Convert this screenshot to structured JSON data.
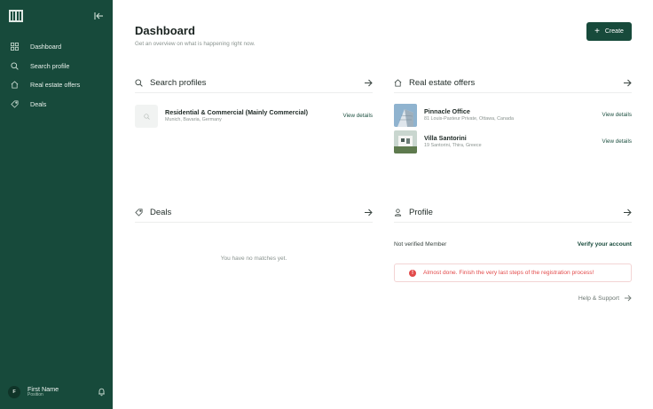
{
  "sidebar": {
    "items": [
      {
        "label": "Dashboard",
        "icon": "grid-icon"
      },
      {
        "label": "Search profile",
        "icon": "search-icon"
      },
      {
        "label": "Real estate offers",
        "icon": "home-icon"
      },
      {
        "label": "Deals",
        "icon": "tag-icon"
      }
    ],
    "user": {
      "initial": "F",
      "name": "First Name",
      "position": "Position"
    }
  },
  "header": {
    "title": "Dashboard",
    "subtitle": "Get an overview on what is happening right now.",
    "create_label": "Create"
  },
  "search_profiles": {
    "title": "Search profiles",
    "items": [
      {
        "title": "Residential & Commercial (Mainly Commercial)",
        "subtitle": "Munich, Bavaria, Germany",
        "link": "View details"
      }
    ]
  },
  "real_estate_offers": {
    "title": "Real estate offers",
    "items": [
      {
        "title": "Pinnacle Office",
        "subtitle": "81 Louis-Pasteur Private, Ottawa, Canada",
        "link": "View details"
      },
      {
        "title": "Villa Santorini",
        "subtitle": "19 Santorini, Thira, Greece",
        "link": "View details"
      }
    ]
  },
  "deals": {
    "title": "Deals",
    "empty": "You have no matches yet."
  },
  "profile": {
    "title": "Profile",
    "status": "Not verified Member",
    "verify_label": "Verify your account",
    "alert": "Almost done. Finish the very last steps of the registration process!",
    "help_label": "Help & Support"
  },
  "colors": {
    "brand": "#174a3b",
    "alert": "#e24a4a"
  }
}
